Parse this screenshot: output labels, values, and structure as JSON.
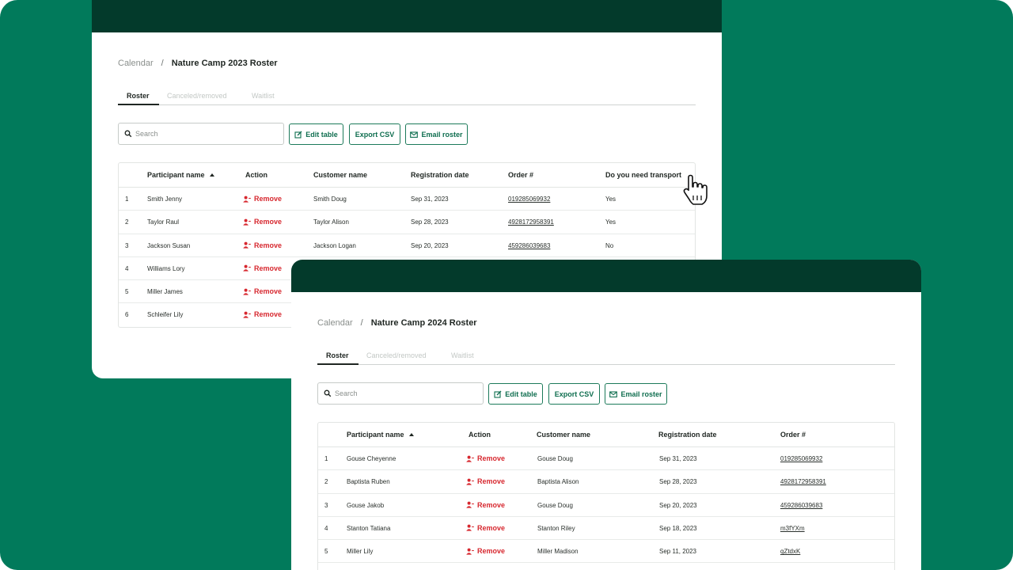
{
  "window_2023": {
    "breadcrumb": {
      "parent": "Calendar",
      "separator": "/",
      "current": "Nature Camp 2023 Roster"
    },
    "tabs": [
      "Roster",
      "Canceled/removed",
      "Waitlist"
    ],
    "search_placeholder": "Search",
    "buttons": {
      "edit_table": "Edit table",
      "export_csv": "Export CSV",
      "email_roster": "Email roster"
    },
    "columns": [
      "Participant name",
      "Action",
      "Customer name",
      "Registration date",
      "Order #",
      "Do you need transport"
    ],
    "rows": [
      {
        "num": "1",
        "participant": "Smith Jenny",
        "action": "Remove",
        "customer": "Smith Doug",
        "date": "Sep 31, 2023",
        "order": "019285069932",
        "transport": "Yes"
      },
      {
        "num": "2",
        "participant": "Taylor Raul",
        "action": "Remove",
        "customer": "Taylor Alison",
        "date": "Sep 28, 2023",
        "order": "4928172958391",
        "transport": "Yes"
      },
      {
        "num": "3",
        "participant": "Jackson Susan",
        "action": "Remove",
        "customer": "Jackson Logan",
        "date": "Sep 20, 2023",
        "order": "459286039683",
        "transport": "No"
      },
      {
        "num": "4",
        "participant": "Williams Lory",
        "action": "Remove"
      },
      {
        "num": "5",
        "participant": "Miller James",
        "action": "Remove"
      },
      {
        "num": "6",
        "participant": "Schleifer Lily",
        "action": "Remove"
      }
    ]
  },
  "window_2024": {
    "breadcrumb": {
      "parent": "Calendar",
      "separator": "/",
      "current": "Nature Camp 2024 Roster"
    },
    "tabs": [
      "Roster",
      "Canceled/removed",
      "Waitlist"
    ],
    "search_placeholder": "Search",
    "buttons": {
      "edit_table": "Edit table",
      "export_csv": "Export CSV",
      "email_roster": "Email roster"
    },
    "columns": [
      "Participant name",
      "Action",
      "Customer name",
      "Registration date",
      "Order #"
    ],
    "rows": [
      {
        "num": "1",
        "participant": "Gouse Cheyenne",
        "action": "Remove",
        "customer": "Gouse Doug",
        "date": "Sep 31, 2023",
        "order": "019285069932"
      },
      {
        "num": "2",
        "participant": "Baptista Ruben",
        "action": "Remove",
        "customer": "Baptista Alison",
        "date": "Sep 28, 2023",
        "order": "4928172958391"
      },
      {
        "num": "3",
        "participant": "Gouse Jakob",
        "action": "Remove",
        "customer": "Gouse Doug",
        "date": "Sep 20, 2023",
        "order": "459286039683"
      },
      {
        "num": "4",
        "participant": "Stanton Tatiana",
        "action": "Remove",
        "customer": "Stanton Riley",
        "date": "Sep 18, 2023",
        "order": "m3fYXm"
      },
      {
        "num": "5",
        "participant": "Miller Lily",
        "action": "Remove",
        "customer": "Miller Madison",
        "date": "Sep 11, 2023",
        "order": "qZtdxK"
      }
    ]
  },
  "colors": {
    "background": "#017a5b",
    "header_bar": "#033a2b",
    "accent": "#0f6e4f",
    "danger": "#d7282f"
  }
}
